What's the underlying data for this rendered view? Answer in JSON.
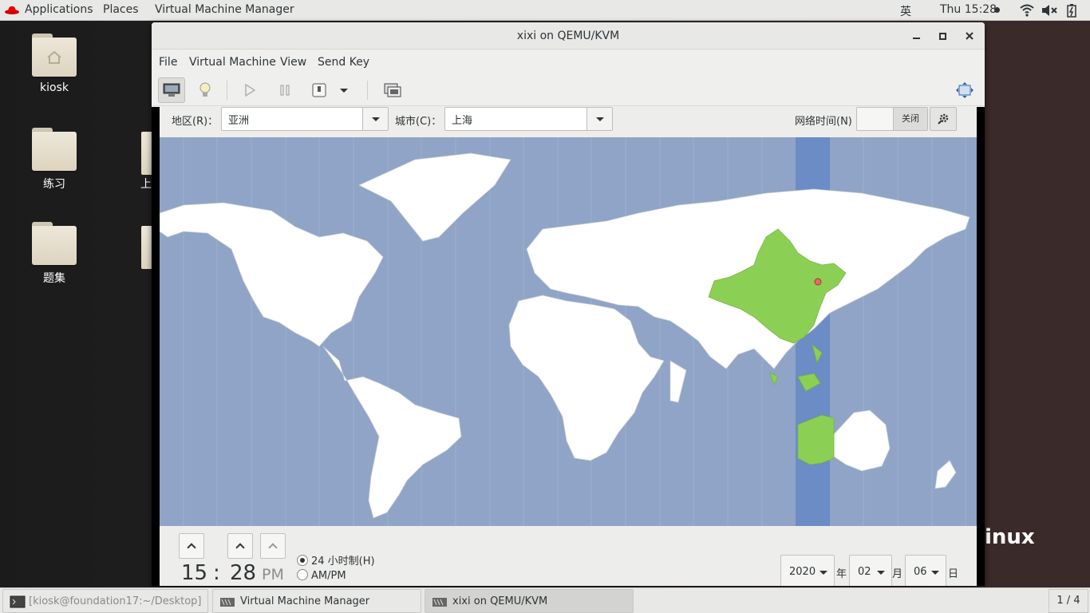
{
  "topbar": {
    "applications": "Applications",
    "places": "Places",
    "app_name": "Virtual Machine Manager",
    "input_method": "英",
    "clock": "Thu 15:28"
  },
  "desktop": {
    "icons": [
      {
        "label": "kiosk",
        "icon": "home-folder-icon"
      },
      {
        "label": "练习",
        "icon": "folder-icon"
      },
      {
        "label": "题集",
        "icon": "folder-icon"
      }
    ],
    "partial_labels": [
      "上"
    ],
    "brand_fragment": "inux"
  },
  "window": {
    "title": "xixi on QEMU/KVM",
    "menu": [
      "File",
      "Virtual Machine",
      "View",
      "Send Key"
    ]
  },
  "guest": {
    "region_label": "地区(R)：",
    "region_value": "亚洲",
    "city_label": "城市(C)：",
    "city_value": "上海",
    "network_time_label": "网络时间(N)",
    "network_time_state": "关闭",
    "hour": "15",
    "separator": ":",
    "minute": "28",
    "ampm": "PM",
    "format_24h": "24 小时制(H)",
    "format_ampm": "AM/PM",
    "format_selected": "24h",
    "year": "2020",
    "year_suffix": "年",
    "month": "02",
    "month_suffix": "月",
    "day": "06",
    "day_suffix": "日",
    "colors": {
      "ocean": "#8fa4c6",
      "timezone_highlight": "#6b8cc4",
      "selected_country": "#8ccf55",
      "land": "#ffffff"
    }
  },
  "taskbar": {
    "items": [
      {
        "label": "[kiosk@foundation17:~/Desktop]"
      },
      {
        "label": "Virtual Machine Manager"
      },
      {
        "label": "xixi on QEMU/KVM"
      }
    ],
    "workspace": "1 / 4"
  }
}
